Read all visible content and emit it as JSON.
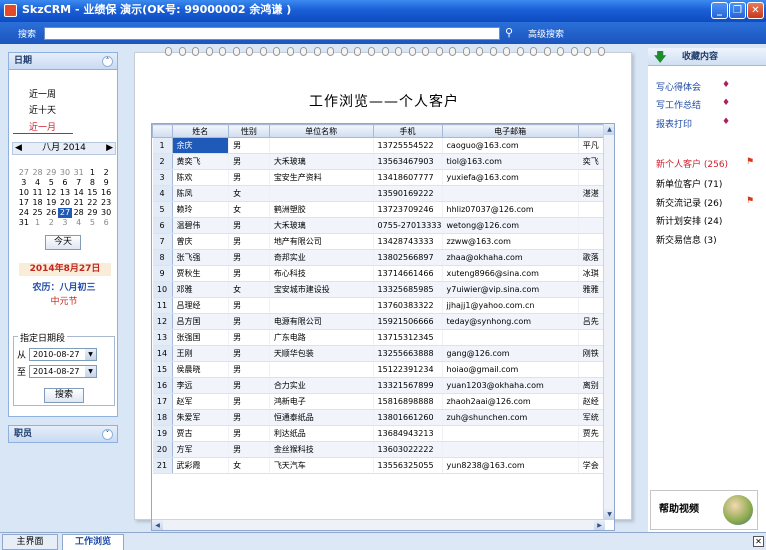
{
  "window": {
    "title": "SkzCRM - 业绩保 演示(OK号: 99000002 余鸿谦 )"
  },
  "search": {
    "label": "搜索",
    "value": "",
    "advanced": "高级搜索"
  },
  "left": {
    "date_header": "日期",
    "ranges": [
      "近一周",
      "近十天",
      "近一月"
    ],
    "calendar": {
      "month_label": "八月",
      "year_label": "2014",
      "weeks": [
        [
          "27",
          "28",
          "29",
          "30",
          "31",
          "1",
          "2"
        ],
        [
          "3",
          "4",
          "5",
          "6",
          "7",
          "8",
          "9"
        ],
        [
          "10",
          "11",
          "12",
          "13",
          "14",
          "15",
          "16"
        ],
        [
          "17",
          "18",
          "19",
          "20",
          "21",
          "22",
          "23"
        ],
        [
          "24",
          "25",
          "26",
          "27",
          "28",
          "29",
          "30"
        ],
        [
          "31",
          "1",
          "2",
          "3",
          "4",
          "5",
          "6"
        ]
      ],
      "selected_day": "27"
    },
    "today_button": "今天",
    "big_date": "2014年8月27日",
    "lunar": "农历：八月初三",
    "festival": "中元节",
    "range_group": {
      "legend": "指定日期段",
      "from_label": "从",
      "from_value": "2010-08-27",
      "to_label": "至",
      "to_value": "2014-08-27",
      "search_button": "搜索"
    },
    "job_header": "职员"
  },
  "doc": {
    "title": "工作浏览——个人客户"
  },
  "table": {
    "columns": [
      "姓名",
      "性别",
      "单位名称",
      "手机",
      "电子邮箱",
      ""
    ],
    "rows": [
      [
        "1",
        "余庆",
        "男",
        "",
        "13725554522",
        "caoguo@163.com",
        "平凡"
      ],
      [
        "2",
        "黄奕飞",
        "男",
        "大禾玻璃",
        "13563467903",
        "tiol@163.com",
        "奕飞"
      ],
      [
        "3",
        "陈欢",
        "男",
        "宝安生产资料",
        "13418607777",
        "yuxiefa@163.com",
        ""
      ],
      [
        "4",
        "陈凤",
        "女",
        "",
        "13590169222",
        "",
        "湛湛"
      ],
      [
        "5",
        "赖玲",
        "女",
        "鹤洲塑胶",
        "13723709246",
        "hhliz07037@126.com",
        ""
      ],
      [
        "6",
        "温碧伟",
        "男",
        "大禾玻璃",
        "0755-27013333",
        "wetong@126.com",
        ""
      ],
      [
        "7",
        "曾庆",
        "男",
        "地产有限公司",
        "13428743333",
        "zzww@163.com",
        ""
      ],
      [
        "8",
        "张飞强",
        "男",
        "奇邦实业",
        "13802566897",
        "zhaa@okhaha.com",
        "歌落"
      ],
      [
        "9",
        "贾秋生",
        "男",
        "布心科技",
        "13714661466",
        "xuteng8966@sina.com",
        "冰琪"
      ],
      [
        "10",
        "邓雅",
        "女",
        "宝安城市建设投",
        "13325685985",
        "y7uiwier@vip.sina.com",
        "雅雅"
      ],
      [
        "11",
        "吕理经",
        "男",
        "",
        "13760383322",
        "jjhajj1@yahoo.com.cn",
        ""
      ],
      [
        "12",
        "吕方国",
        "男",
        "电源有限公司",
        "15921506666",
        "teday@synhong.com",
        "吕先"
      ],
      [
        "13",
        "张强国",
        "男",
        "广东电路",
        "13715312345",
        "",
        ""
      ],
      [
        "14",
        "王刚",
        "男",
        "天顺华包装",
        "13255663888",
        "gang@126.com",
        "刚铁"
      ],
      [
        "15",
        "侯晨晓",
        "男",
        "",
        "15122391234",
        "hoiao@gmail.com",
        ""
      ],
      [
        "16",
        "李远",
        "男",
        "合力实业",
        "13321567899",
        "yuan1203@okhaha.com",
        "离别"
      ],
      [
        "17",
        "赵军",
        "男",
        "鸿新电子",
        "15816898888",
        "zhaoh2aai@126.com",
        "赵经"
      ],
      [
        "18",
        "朱爱军",
        "男",
        "恒通泰纸品",
        "13801661260",
        "zuh@shunchen.com",
        "军统"
      ],
      [
        "19",
        "贾古",
        "男",
        "利达纸品",
        "13684943213",
        "",
        "贾先"
      ],
      [
        "20",
        "方军",
        "男",
        "金丝猴科技",
        "13603022222",
        "",
        ""
      ],
      [
        "21",
        "武彩霞",
        "女",
        "飞天汽车",
        "13556325055",
        "yun8238@163.com",
        "学会"
      ]
    ]
  },
  "right": {
    "header": "收藏内容",
    "links": [
      "写心得体会",
      "写工作总结",
      "报表打印"
    ],
    "items": [
      "新个人客户 (256)",
      "新单位客户 (71)",
      "新交流记录 (26)",
      "新计划安排 (24)",
      "新交易信息 (3)"
    ],
    "help": "帮助视频"
  },
  "tabs": [
    "主界面",
    "工作浏览"
  ],
  "colors": {
    "accent": "#1f5ab8",
    "title_bar": "#1a5fd6",
    "highlight_red": "#d0202b"
  }
}
